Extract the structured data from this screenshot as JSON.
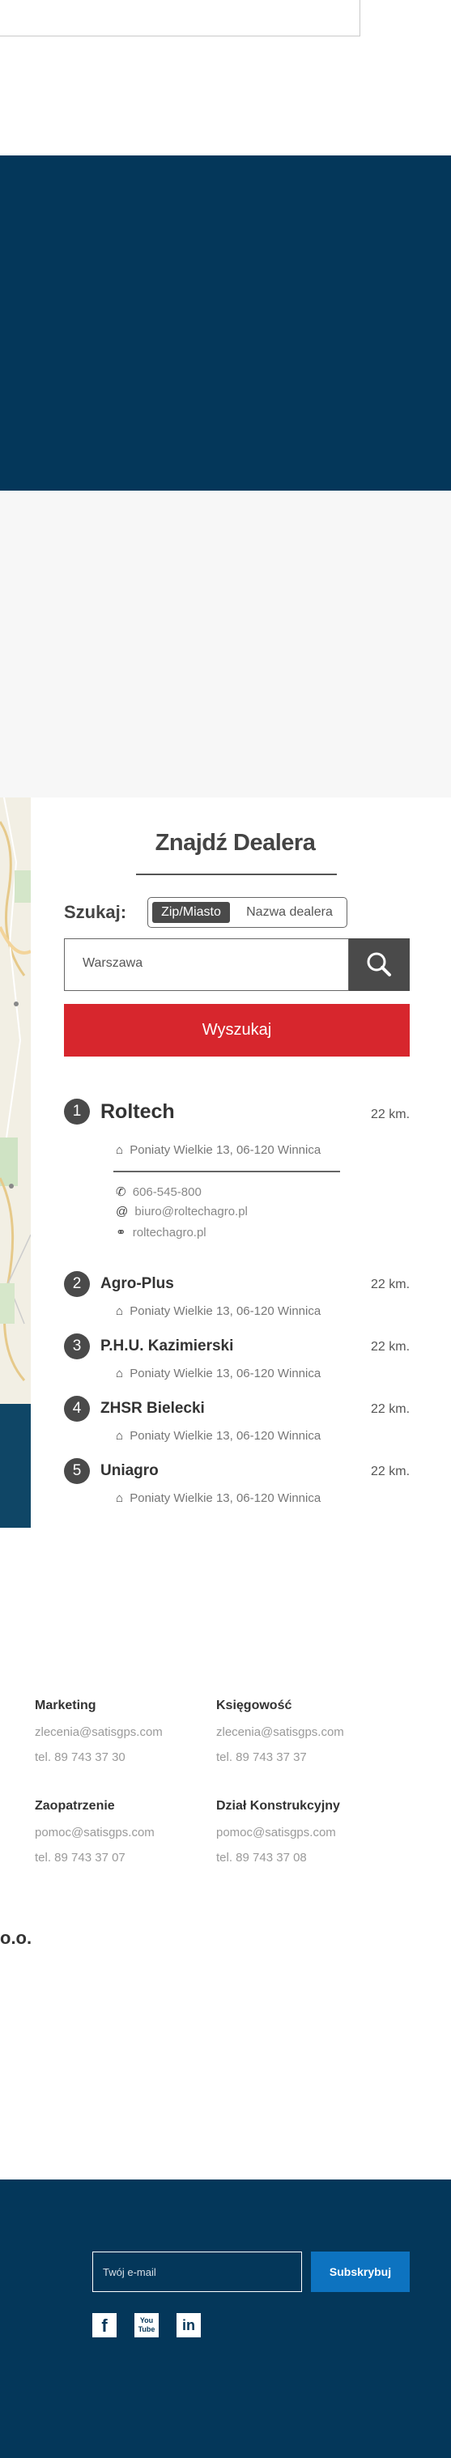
{
  "dealer_finder": {
    "title": "Znajdź Dealera",
    "search_label": "Szukaj:",
    "toggle": {
      "zip": "Zip/Miasto",
      "name": "Nazwa dealera"
    },
    "search_value": "Warszawa",
    "submit_label": "Wyszukaj",
    "dealers": [
      {
        "num": "1",
        "name": "Roltech",
        "distance": "22 km.",
        "address": "Poniaty Wielkie 13, 06-120 Winnica",
        "phone": "606-545-800",
        "email": "biuro@roltechagro.pl",
        "website": "roltechagro.pl"
      },
      {
        "num": "2",
        "name": "Agro-Plus",
        "distance": "22 km.",
        "address": "Poniaty Wielkie 13, 06-120 Winnica"
      },
      {
        "num": "3",
        "name": "P.H.U. Kazimierski",
        "distance": "22 km.",
        "address": "Poniaty Wielkie 13, 06-120 Winnica"
      },
      {
        "num": "4",
        "name": "ZHSR Bielecki",
        "distance": "22 km.",
        "address": "Poniaty Wielkie 13, 06-120 Winnica"
      },
      {
        "num": "5",
        "name": "Uniagro",
        "distance": "22 km.",
        "address": "Poniaty Wielkie 13, 06-120 Winnica"
      }
    ]
  },
  "contacts": [
    {
      "head": "Marketing",
      "email": "zlecenia@satisgps.com",
      "phone": "tel. 89 743 37 30"
    },
    {
      "head": "Księgowość",
      "email": "zlecenia@satisgps.com",
      "phone": "tel. 89 743 37 37"
    },
    {
      "head": "Zaopatrzenie",
      "email": "pomoc@satisgps.com",
      "phone": "tel. 89 743 37 07"
    },
    {
      "head": "Dział Konstrukcyjny",
      "email": "pomoc@satisgps.com",
      "phone": "tel. 89 743 37 08"
    }
  ],
  "company_fragment": "o.o.",
  "footer": {
    "email_placeholder": "Twój e-mail",
    "subscribe_label": "Subskrybuj",
    "social": [
      {
        "icon": "facebook-icon",
        "glyph": "f"
      },
      {
        "icon": "youtube-icon",
        "glyph": "You Tube"
      },
      {
        "icon": "linkedin-icon",
        "glyph": "in"
      }
    ]
  },
  "colors": {
    "navy": "#04375a",
    "red": "#d7262d",
    "blue": "#0d73c0",
    "dark_grey": "#4a4a4a",
    "light_grey": "#f7f7f7"
  },
  "icons": {
    "search": "magnifier-icon",
    "home": "home-icon",
    "phone": "phone-icon",
    "email": "at-icon",
    "web": "globe-icon"
  }
}
